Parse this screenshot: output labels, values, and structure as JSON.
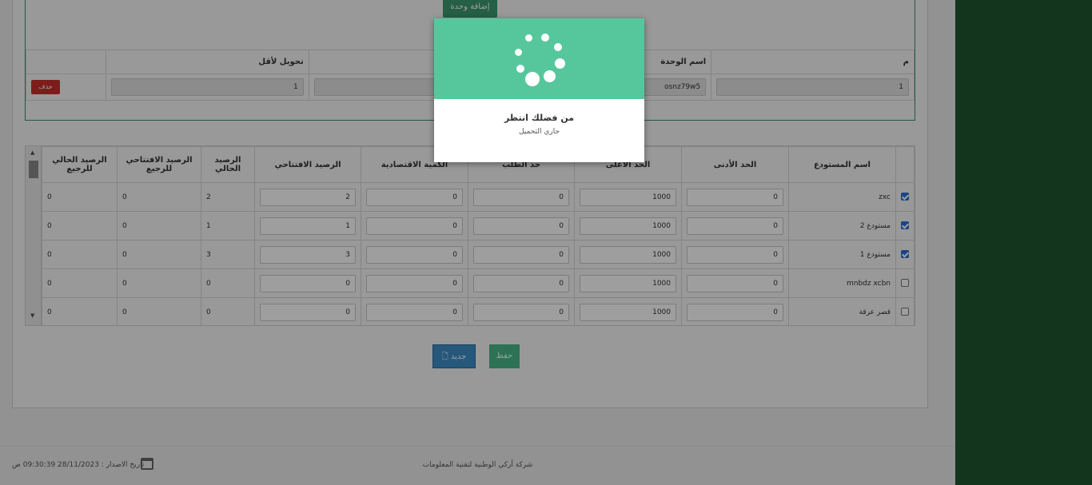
{
  "units": {
    "add_unit_label": "إضافة وحدة",
    "headers": {
      "index": "م",
      "unit_name": "اسم الوحدة",
      "to_smaller": "تحويل لأقل"
    },
    "row": {
      "index": "1",
      "unit_name": "osnz79w5",
      "to_smaller": "1",
      "delete_label": "حذف"
    }
  },
  "warehouses": {
    "headers": {
      "name": "اسم المستودع",
      "min": "الحد الأدنى",
      "max": "الحد الأعلى",
      "reorder": "حد الطلب",
      "economic": "الكمية الاقتصادية",
      "opening": "الرصيد الافتتاحي",
      "current": "الرصيد الحالي",
      "opening_return": "الرصيد الافتتاحي للرجيع",
      "current_return": "الرصيد الحالي للرجيع"
    },
    "rows": [
      {
        "checked": true,
        "name": "zxc",
        "min": "0",
        "max": "1000",
        "reorder": "0",
        "economic": "0",
        "opening": "2",
        "current": "2",
        "opening_return": "0",
        "current_return": "0"
      },
      {
        "checked": true,
        "name": "مستودع 2",
        "min": "0",
        "max": "1000",
        "reorder": "0",
        "economic": "0",
        "opening": "1",
        "current": "1",
        "opening_return": "0",
        "current_return": "0"
      },
      {
        "checked": true,
        "name": "مستودع 1",
        "min": "0",
        "max": "1000",
        "reorder": "0",
        "economic": "0",
        "opening": "3",
        "current": "3",
        "opening_return": "0",
        "current_return": "0"
      },
      {
        "checked": false,
        "name": "mnbdz xcbn",
        "min": "0",
        "max": "1000",
        "reorder": "0",
        "economic": "0",
        "opening": "0",
        "current": "0",
        "opening_return": "0",
        "current_return": "0"
      },
      {
        "checked": false,
        "name": "قصر عرقة",
        "min": "0",
        "max": "1000",
        "reorder": "0",
        "economic": "0",
        "opening": "0",
        "current": "0",
        "opening_return": "0",
        "current_return": "0"
      }
    ]
  },
  "actions": {
    "new_label": "جديد",
    "save_label": "حفظ"
  },
  "footer": {
    "company": "شركة أركي الوطنية لتقنية المعلومات",
    "release": "تاريخ الاصدار : 28/11/2023 09:30:39 ص"
  },
  "modal": {
    "title": "من فضلك انتظر",
    "subtitle": "جاري التحميل"
  },
  "colors": {
    "accent": "#56c79d",
    "brand_dark": "#1f5530",
    "danger": "#c9302c",
    "primary": "#3e8fc9"
  },
  "icons": {
    "new": "file-icon",
    "release": "calendar-icon",
    "loader": "spinner-icon"
  }
}
